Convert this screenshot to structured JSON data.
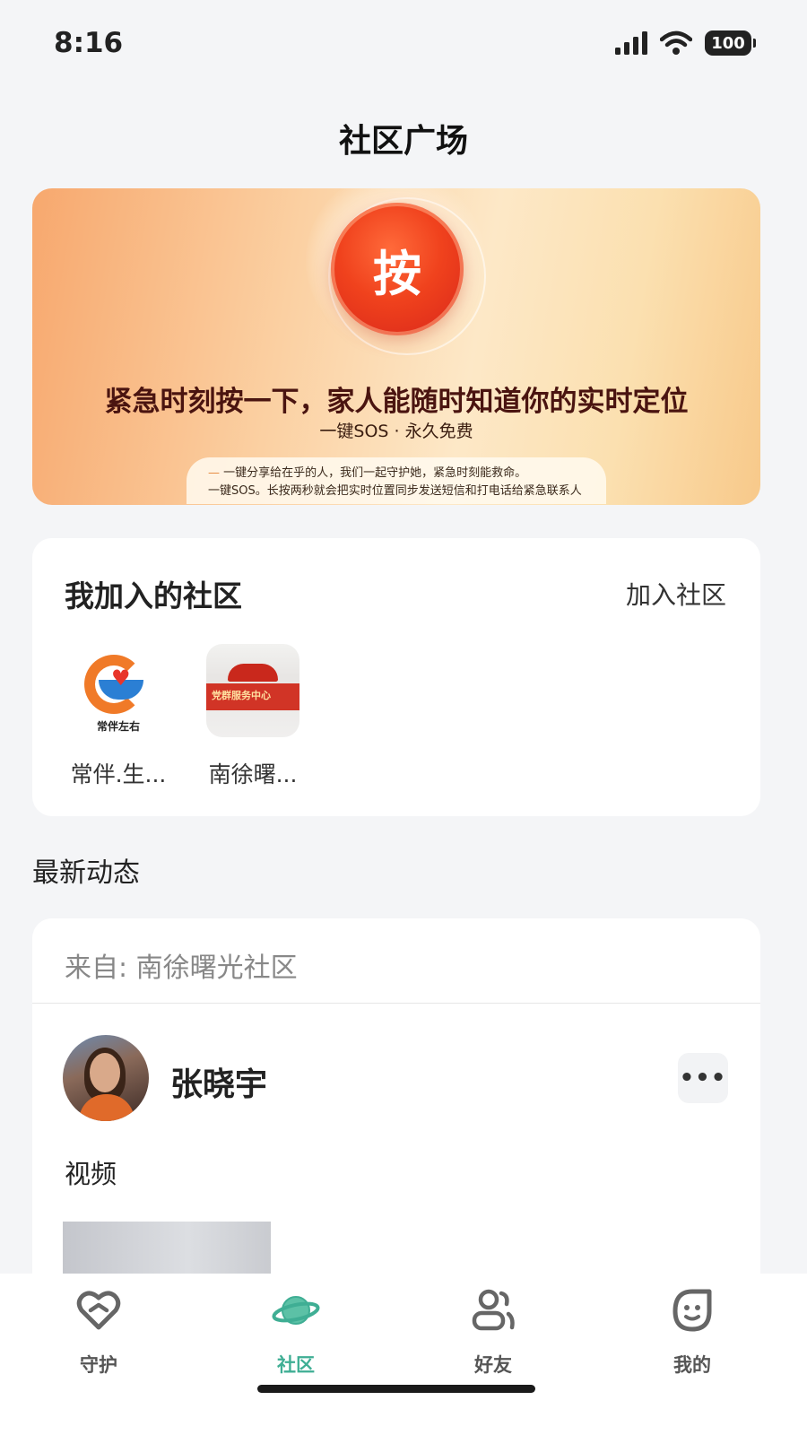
{
  "status_bar": {
    "time": "8:16",
    "battery": "100"
  },
  "header": {
    "title": "社区广场"
  },
  "banner": {
    "button_label": "按",
    "headline": "紧急时刻按一下，家人能随时知道你的实时定位",
    "subtitle": "一键SOS · 永久免费",
    "note_line1": "一键分享给在乎的人，我们一起守护她，紧急时刻能救命。",
    "note_line2": "一键SOS。长按两秒就会把实时位置同步发送短信和打电话给紧急联系人"
  },
  "communities": {
    "title": "我加入的社区",
    "join_label": "加入社区",
    "items": [
      {
        "name": "常伴.生...",
        "logo_text": "常伴左右"
      },
      {
        "name": "南徐曙...",
        "photo_text": "党群服务中心"
      }
    ]
  },
  "feed": {
    "section_title": "最新动态",
    "post": {
      "from": "来自: 南徐曙光社区",
      "author": "张晓宇",
      "more": "•••",
      "text": "视频"
    }
  },
  "tabs": [
    {
      "label": "守护",
      "icon": "heart-shield-icon",
      "active": false
    },
    {
      "label": "社区",
      "icon": "planet-icon",
      "active": true
    },
    {
      "label": "好友",
      "icon": "friends-icon",
      "active": false
    },
    {
      "label": "我的",
      "icon": "face-icon",
      "active": false
    }
  ],
  "colors": {
    "accent": "#3fae94",
    "sos": "#e63a1e",
    "background": "#f4f5f7"
  }
}
